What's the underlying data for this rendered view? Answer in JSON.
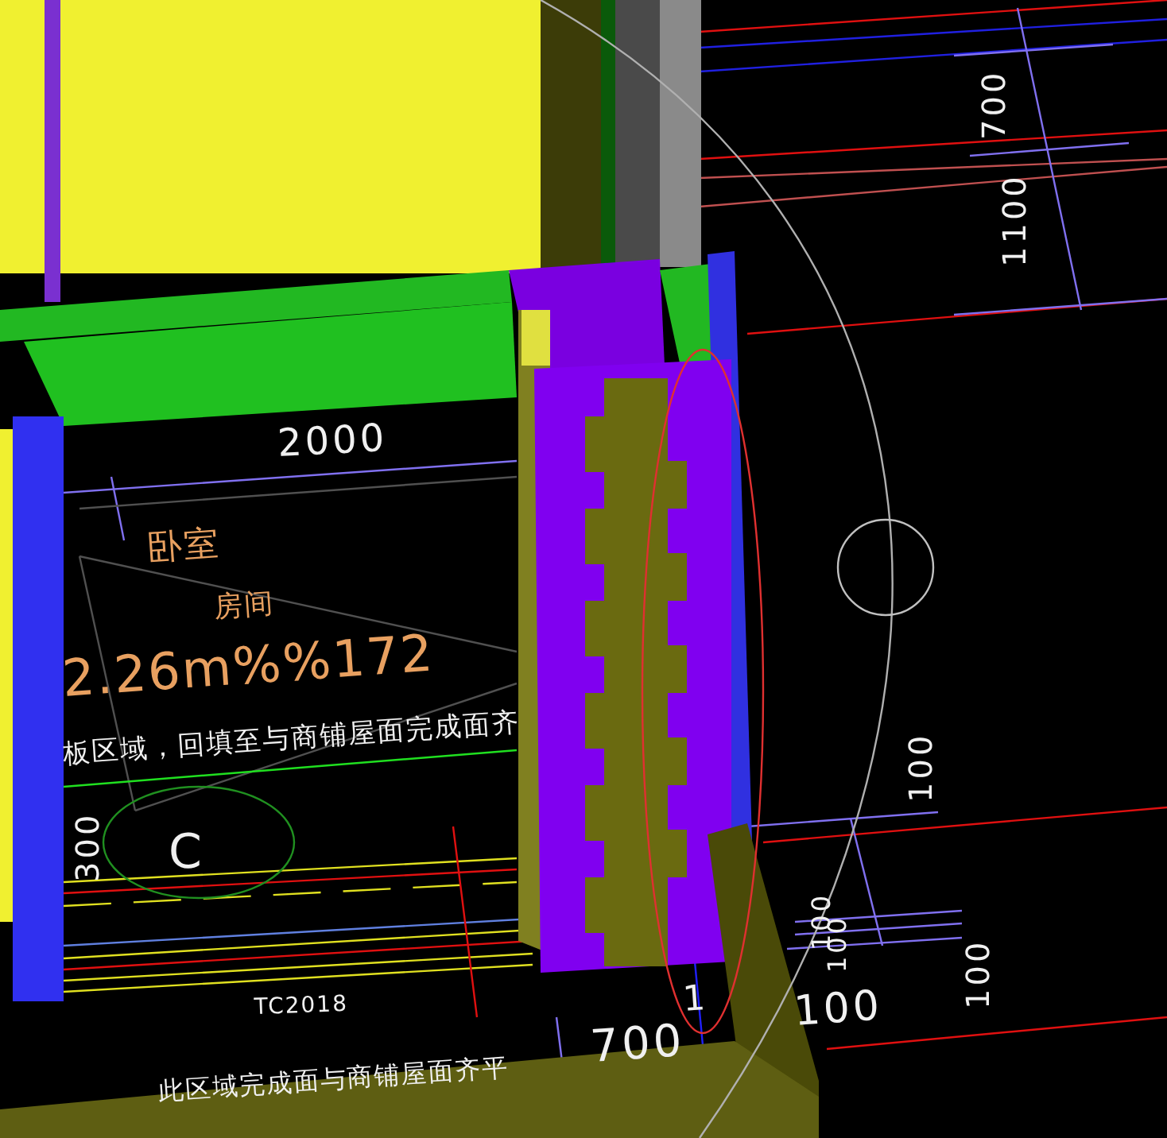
{
  "viewport": {
    "annotations": [
      {
        "text": "2000",
        "kind": "dimension"
      },
      {
        "text": "卧室",
        "kind": "room"
      },
      {
        "text": "房间",
        "kind": "room"
      },
      {
        "text": "2.26m%%172",
        "kind": "room"
      },
      {
        "text": "板区域，回填至与商铺屋面完成面齐",
        "kind": "note"
      },
      {
        "text": "300",
        "kind": "dimension"
      },
      {
        "text": "C",
        "kind": "note"
      },
      {
        "text": "TC2018",
        "kind": "note"
      },
      {
        "text": "此区域完成面与商铺屋面齐平",
        "kind": "note"
      },
      {
        "text": "700",
        "kind": "dimension"
      },
      {
        "text": "1",
        "kind": "dimension"
      },
      {
        "text": "100",
        "kind": "dimension"
      },
      {
        "text": "700",
        "kind": "dimension"
      },
      {
        "text": "1100",
        "kind": "dimension"
      },
      {
        "text": "100",
        "kind": "dimension"
      },
      {
        "text": "100",
        "kind": "dimension"
      },
      {
        "text": "100",
        "kind": "dimension"
      },
      {
        "text": "100",
        "kind": "dimension"
      }
    ]
  }
}
